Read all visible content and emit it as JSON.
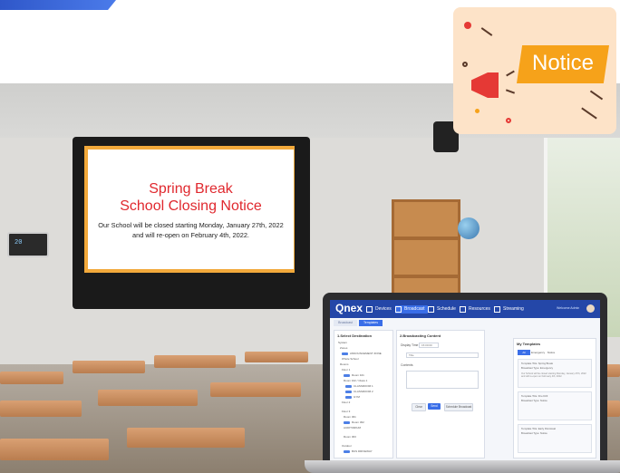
{
  "brand": {
    "top_bar_color": "#2f57c9"
  },
  "tv": {
    "title_line1": "Spring Break",
    "title_line2": "School Closing Notice",
    "message": "Our School will be closed starting Monday, January 27th, 2022 and will re-open on February 4th, 2022.",
    "title_color": "#e0282e",
    "accent_color": "#f2a93b"
  },
  "notice": {
    "label": "Notice",
    "banner_color": "#f6a21a",
    "icon": "megaphone-icon"
  },
  "thermostat": {
    "display": "20"
  },
  "app": {
    "logo": "Qnex",
    "nav": [
      {
        "label": "Devices",
        "icon": "monitor-icon"
      },
      {
        "label": "Broadcast",
        "icon": "broadcast-icon"
      },
      {
        "label": "Schedule",
        "icon": "calendar-icon"
      },
      {
        "label": "Resources",
        "icon": "folder-icon"
      },
      {
        "label": "Streaming",
        "icon": "stream-icon"
      }
    ],
    "active_nav": "Broadcast",
    "user": "Welcome  Admin",
    "sub_tabs": [
      "Broadcast",
      "Templates"
    ],
    "destination_panel": {
      "title": "1.Select Destination",
      "rows": [
        "System",
        "Zones",
        "ANNOUNCEMENT ZONE",
        "Whole School",
        "Rooms",
        "Floor 1",
        "Room 101",
        "Room 102 / Class 1",
        "CLASSROOM 1",
        "CLASSROOM 2",
        "GYM",
        "Floor 2",
        "Floor 3",
        "Room 301",
        "Room 302",
        "AUDITORIUM",
        "Room 303",
        "Outdoor",
        "BUS DRIVEWAY"
      ]
    },
    "broadcast_panel": {
      "title": "2.Broadcasting Content",
      "type_label": "Display Time",
      "type_value": "15:00:00",
      "select_value": "Title",
      "content_label": "Contents",
      "cancel_label": "Clear",
      "send_label": "Send",
      "schedule_label": "Schedule Broadcast"
    },
    "templates_panel": {
      "title": "My Templates",
      "tabs": [
        "All",
        "Emergency",
        "Notice"
      ],
      "cards": [
        {
          "name": "Template Title: Spring Break",
          "type": "Broadcast Type: Emergency"
        },
        {
          "name": "Template Title: Fire Drill",
          "type": "Broadcast Type: Notice"
        },
        {
          "name": "Template Title: Early Dismissal",
          "type": "Broadcast Type: Notice"
        }
      ]
    }
  }
}
